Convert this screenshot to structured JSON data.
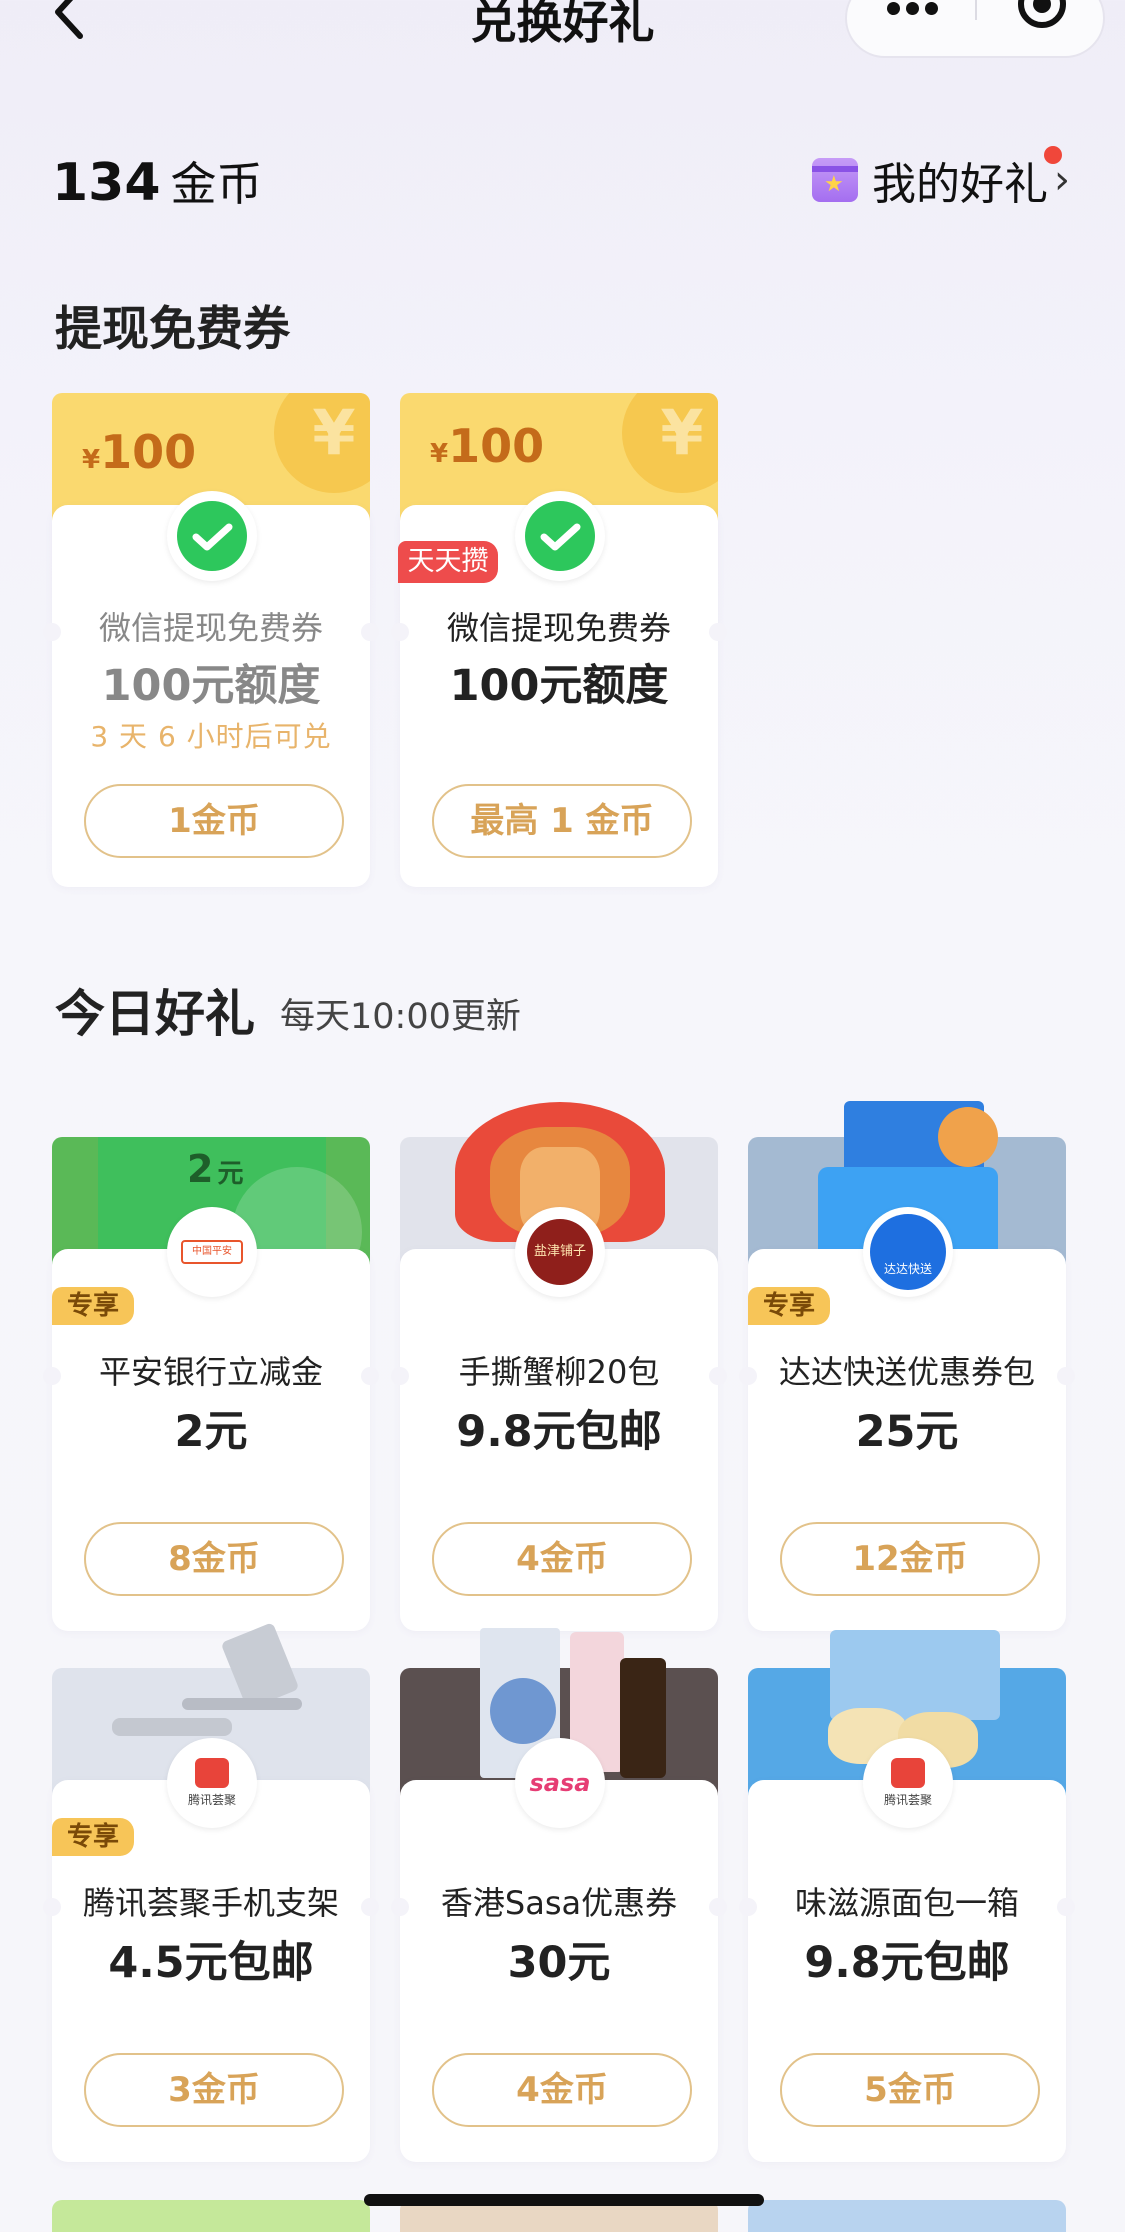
{
  "nav": {
    "title": "兑换好礼"
  },
  "header": {
    "coins_value": "134",
    "coins_unit": "金币",
    "my_gifts_label": "我的好礼"
  },
  "sections": {
    "withdraw": {
      "title": "提现免费券"
    },
    "today": {
      "title": "今日好礼",
      "subtitle": "每天10:00更新"
    }
  },
  "coupons": [
    {
      "symbol": "¥",
      "amount": "100",
      "name": "微信提现免费券",
      "value": "100元额度",
      "countdown": "3 天 6 小时后可兑",
      "button": "1金币"
    },
    {
      "symbol": "¥",
      "amount": "100",
      "tag": "天天攒",
      "name": "微信提现免费券",
      "value": "100元额度",
      "button": "最高 1 金币"
    }
  ],
  "products": [
    {
      "name": "平安银行立减金",
      "value": "2元",
      "button": "8金币",
      "tag": "专享",
      "art_text": "2",
      "art_unit": "元",
      "logo_text": "中国平安"
    },
    {
      "name": "手撕蟹柳20包",
      "value": "9.8元包邮",
      "button": "4金币",
      "logo_text": "盐津铺子"
    },
    {
      "name": "达达快送优惠券包",
      "value": "25元",
      "button": "12金币",
      "tag": "专享",
      "logo_text": "达达快送"
    },
    {
      "name": "腾讯荟聚手机支架",
      "value": "4.5元包邮",
      "button": "3金币",
      "tag": "专享",
      "logo_text": "腾讯荟聚"
    },
    {
      "name": "香港Sasa优惠券",
      "value": "30元",
      "button": "4金币",
      "logo_text": "sasa"
    },
    {
      "name": "味滋源面包一箱",
      "value": "9.8元包邮",
      "button": "5金币",
      "logo_text": "腾讯荟聚"
    }
  ],
  "colors": {
    "accent_gold": "#d8a358",
    "coupon_yellow": "#fad96f",
    "tag_red": "#ee4c4c",
    "tag_gold": "#f7c558"
  }
}
